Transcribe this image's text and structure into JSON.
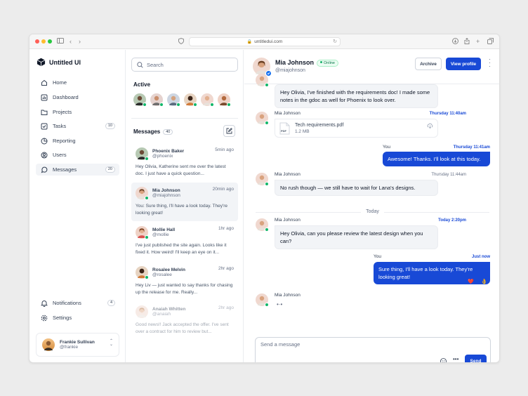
{
  "browser": {
    "url": "untitledui.com",
    "colors": {
      "close": "#ff5f57",
      "minimize": "#febc2e",
      "maximize": "#28c840"
    }
  },
  "sidebar": {
    "brand": "Untitled UI",
    "nav": [
      {
        "label": "Home",
        "icon": "home-icon"
      },
      {
        "label": "Dashboard",
        "icon": "bar-chart-icon"
      },
      {
        "label": "Projects",
        "icon": "folder-icon"
      },
      {
        "label": "Tasks",
        "icon": "check-square-icon",
        "badge": "10"
      },
      {
        "label": "Reporting",
        "icon": "pie-chart-icon"
      },
      {
        "label": "Users",
        "icon": "user-icon"
      },
      {
        "label": "Messages",
        "icon": "message-icon",
        "badge": "20",
        "active": true
      }
    ],
    "footer_nav": [
      {
        "label": "Notifications",
        "icon": "bell-icon",
        "badge": "4"
      },
      {
        "label": "Settings",
        "icon": "gear-icon"
      }
    ],
    "user": {
      "name": "Frankie Sullivan",
      "handle": "@frankie"
    }
  },
  "list": {
    "search_placeholder": "Search",
    "active_title": "Active",
    "messages_title": "Messages",
    "messages_count": "40",
    "conversations": [
      {
        "name": "Phoenix Baker",
        "handle": "@phoenix",
        "time": "5min ago",
        "preview": "Hey Olivia, Katherine sent me over the latest doc. I just have a quick question..."
      },
      {
        "name": "Mia Johnson",
        "handle": "@miajohnson",
        "time": "20min ago",
        "preview": "You: Sure thing, I'll have a look today. They're looking great!"
      },
      {
        "name": "Mollie Hall",
        "handle": "@mollie",
        "time": "1hr ago",
        "preview": "I've just published the site again. Looks like it fixed it. How weird! I'll keep an eye on it..."
      },
      {
        "name": "Rosalee Melvin",
        "handle": "@rosalee",
        "time": "2hr ago",
        "preview": "Hey Liv — just wanted to say thanks for chasing up the release for me. Really..."
      },
      {
        "name": "Anaiah Whitten",
        "handle": "@anaiah",
        "time": "2hr ago",
        "preview": "Good news!! Jack accepted the offer. I've sent over a contract for him to review but..."
      }
    ]
  },
  "chat": {
    "contact_name": "Mia Johnson",
    "status": "Online",
    "contact_handle": "@miajohnson",
    "archive_label": "Archive",
    "view_profile_label": "View profile",
    "messages": {
      "m1_text": "Hey Olivia, I've finished with the requirements doc! I made some notes in the gdoc as well for Phoenix to look over.",
      "m2_name": "Mia Johnson",
      "m2_time": "Thursday 11:40am",
      "file_name": "Tech requirements.pdf",
      "file_size": "1.2 MB",
      "file_type": "PDF",
      "m3_name": "You",
      "m3_time": "Thursday 11:41am",
      "m3_text": "Awesome! Thanks. I'll look at this today.",
      "m4_name": "Mia Johnson",
      "m4_time": "Thursday 11:44am",
      "m4_text": "No rush though — we still have to wait for Lana's designs.",
      "divider": "Today",
      "m5_name": "Mia Johnson",
      "m5_time": "Today 2:20pm",
      "m5_text": "Hey Olivia, can you please review the latest design when you can?",
      "m6_name": "You",
      "m6_time": "Just now",
      "m6_text": "Sure thing, I'll have a look today. They're looking great!",
      "reactions": [
        "❤️",
        "👌"
      ],
      "m7_name": "Mia Johnson",
      "m7_typing": "•·•"
    },
    "composer_placeholder": "Send a message",
    "send_label": "Send"
  }
}
